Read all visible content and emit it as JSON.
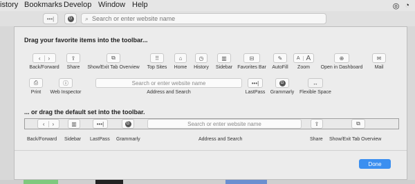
{
  "menubar": {
    "items": [
      "istory",
      "Bookmarks",
      "Develop",
      "Window",
      "Help"
    ]
  },
  "safari": {
    "search_placeholder": "Search or enter website name"
  },
  "sheet": {
    "title": "Drag your favorite items into the toolbar...",
    "title2": "... or drag the default set into the toolbar.",
    "items": {
      "back_forward": "Back/Forward",
      "share": "Share",
      "show_exit_tab_overview": "Show/Exit Tab Overview",
      "top_sites": "Top Sites",
      "home": "Home",
      "history": "History",
      "sidebar": "Sidebar",
      "favorites_bar": "Favorites Bar",
      "autofill": "AutoFill",
      "zoom": "Zoom",
      "open_in_dashboard": "Open in Dashboard",
      "mail": "Mail",
      "print": "Print",
      "web_inspector": "Web Inspector",
      "address_and_search": "Address and Search",
      "lastpass": "LastPass",
      "grammarly": "Grammarly",
      "flexible_space": "Flexible Space"
    },
    "address_placeholder": "Search or enter website name",
    "default_set": {
      "back_forward": "Back/Forward",
      "sidebar": "Sidebar",
      "lastpass": "LastPass",
      "grammarly": "Grammarly",
      "address_and_search": "Address and Search",
      "share": "Share",
      "show_exit_tab_overview": "Show/Exit Tab Overview",
      "address_placeholder": "Search or enter website name"
    },
    "done_label": "Done"
  },
  "colors": {
    "accent": "#3b8ff0",
    "sheet_bg": "#ececec"
  }
}
